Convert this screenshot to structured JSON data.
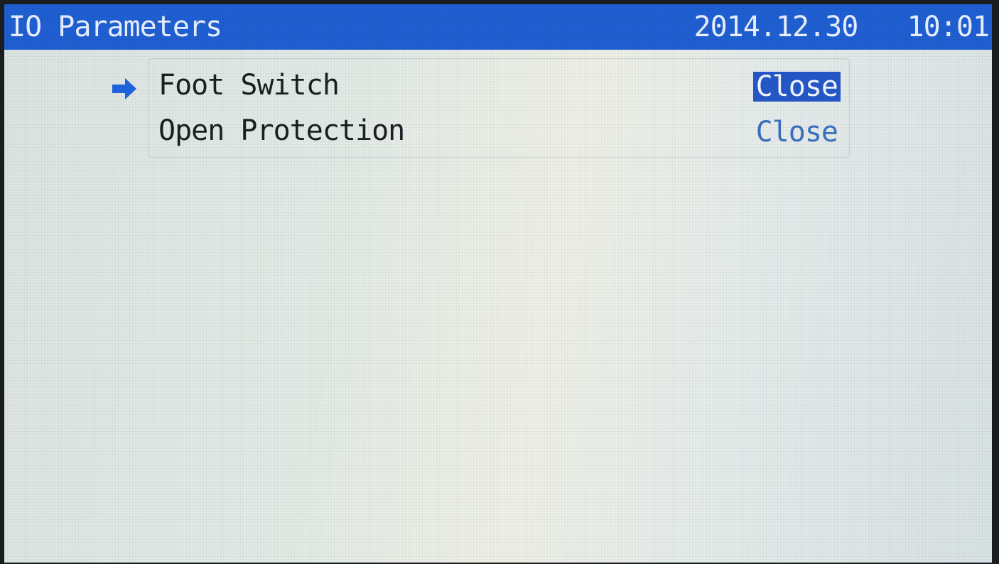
{
  "header": {
    "title": "IO Parameters",
    "date": "2014.12.30",
    "time": "10:01"
  },
  "menu": {
    "items": [
      {
        "label": "Foot Switch",
        "value": "Close",
        "selected": true
      },
      {
        "label": "Open Protection",
        "value": "Close",
        "selected": false
      }
    ]
  },
  "icons": {
    "cursor": "right-arrow-icon"
  },
  "colors": {
    "title_bar": "#1f5fd2",
    "value_text": "#3a70c0",
    "selected_highlight": "#2458c8"
  }
}
